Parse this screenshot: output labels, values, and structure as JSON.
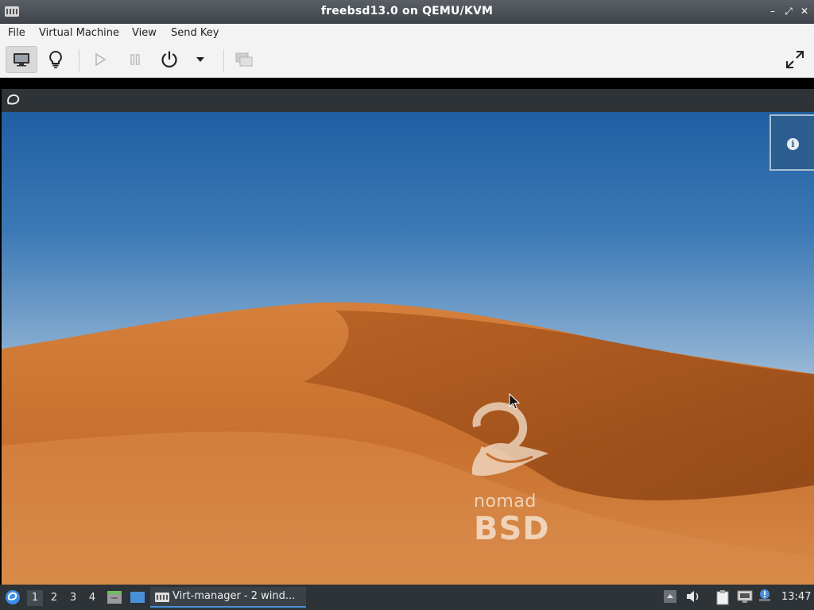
{
  "window": {
    "title": "freebsd13.0 on QEMU/KVM",
    "controls": {
      "minimize": "–",
      "maximize": "⤢",
      "close": "✕"
    }
  },
  "menu": [
    "File",
    "Virtual Machine",
    "View",
    "Send Key"
  ],
  "toolbar": {
    "buttons": [
      {
        "icon": "monitor-icon",
        "state": "active"
      },
      {
        "icon": "lightbulb-icon",
        "state": "normal"
      },
      {
        "icon": "play-icon",
        "state": "disabled"
      },
      {
        "icon": "pause-icon",
        "state": "disabled"
      },
      {
        "icon": "power-icon",
        "state": "normal"
      },
      {
        "icon": "chevron-down-icon",
        "state": "normal"
      },
      {
        "icon": "screenshot-icon",
        "state": "disabled"
      },
      {
        "icon": "fullscreen-icon",
        "state": "normal"
      }
    ]
  },
  "guest": {
    "wallpaper": {
      "brand_top": "nomad",
      "brand_bottom": "BSD"
    },
    "taskbar": {
      "workspaces": [
        "1",
        "2",
        "3",
        "4"
      ],
      "active_workspace": "1",
      "task_label": "Virt-manager - 2 wind...",
      "clock": "13:47"
    }
  },
  "colors": {
    "titlebar": "#4a4f55",
    "toolbar": "#f3f3f3",
    "guest_panel": "#2e3337",
    "sky": "#2a6aad",
    "sand": "#c96f2f",
    "accent": "#4a90d9"
  }
}
